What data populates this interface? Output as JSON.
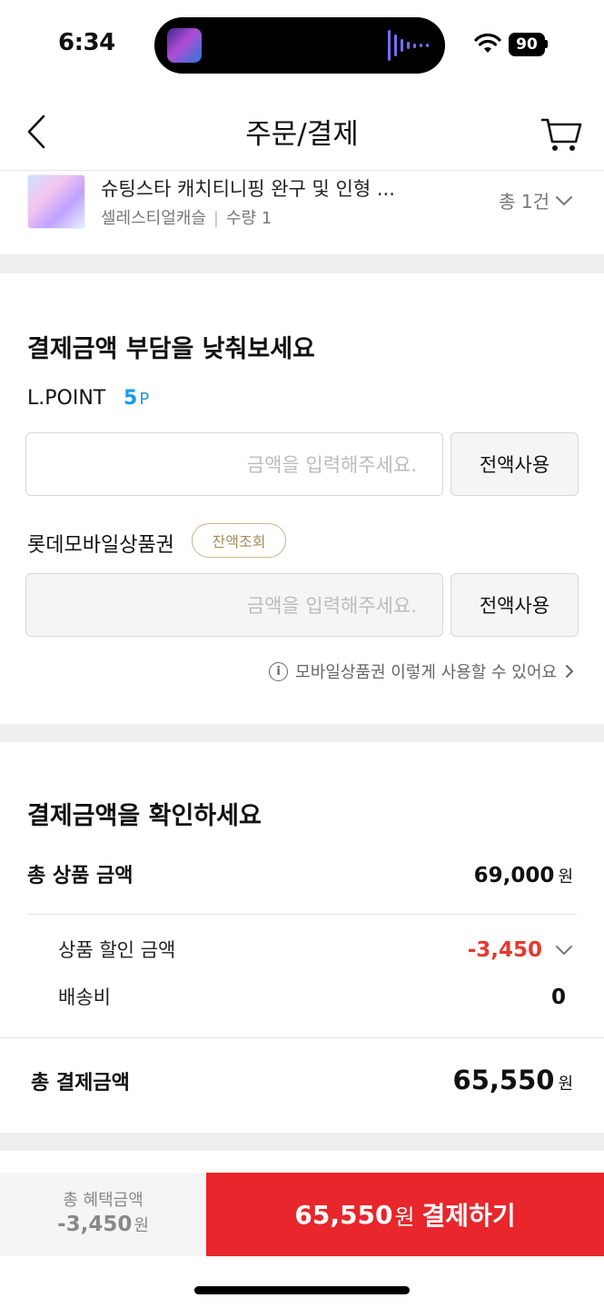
{
  "status_bar": {
    "time": "6:34",
    "battery": "90"
  },
  "header": {
    "title": "주문/결제"
  },
  "product": {
    "name": "슈팅스타 캐치티니핑 완구 및 인형 ...",
    "brand": "셀레스티얼캐슬",
    "quantity": "수량 1",
    "total_count": "총 1건"
  },
  "discount": {
    "title": "결제금액 부담을 낮춰보세요",
    "lpoint_label": "L.POINT",
    "lpoint_value": "5",
    "lpoint_unit": "P",
    "amount_placeholder": "금액을 입력해주세요.",
    "use_all_label": "전액사용",
    "giftcard_label": "롯데모바일상품권",
    "balance_check_label": "잔액조회",
    "giftcard_placeholder": "금액을 입력해주세요.",
    "giftcard_use_all_label": "전액사용",
    "info_link": "모바일상품권 이렇게 사용할 수 있어요"
  },
  "summary": {
    "title": "결제금액을 확인하세요",
    "total_product_label": "총 상품 금액",
    "total_product_value": "69,000",
    "discount_label": "상품 할인 금액",
    "discount_value": "-3,450",
    "shipping_label": "배송비",
    "shipping_value": "0",
    "total_payment_label": "총 결제금액",
    "total_payment_value": "65,550",
    "currency": "원"
  },
  "bottom_bar": {
    "benefit_label": "총 혜택금액",
    "benefit_value": "-3,450",
    "benefit_unit": "원",
    "pay_amount": "65,550",
    "pay_unit": "원",
    "pay_label": "결제하기"
  },
  "colors": {
    "accent_red": "#e8262b",
    "point_blue": "#1a9be6",
    "balance_gold": "#a98a55"
  }
}
